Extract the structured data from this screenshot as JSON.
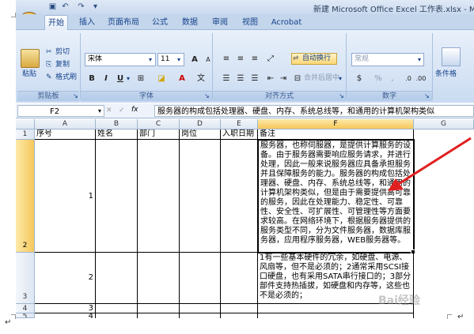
{
  "titlebar": {
    "title": "新建 Microsoft Office Excel 工作表.xlsx - M"
  },
  "tabs": [
    "开始",
    "插入",
    "页面布局",
    "公式",
    "数据",
    "审阅",
    "视图",
    "Acrobat"
  ],
  "ribbon": {
    "clipboard": {
      "paste": "粘贴",
      "cut": "剪切",
      "copy": "复制",
      "format_painter": "格式刷",
      "label": "剪贴板"
    },
    "font": {
      "name": "宋体",
      "size": "11",
      "bold": "B",
      "italic": "I",
      "underline": "U",
      "grow": "A",
      "shrink": "A",
      "label": "字体"
    },
    "alignment": {
      "wrap": "自动换行",
      "merge": "合并后居中",
      "label": "对齐方式"
    },
    "number": {
      "format": "常规",
      "percent": "%",
      "comma": ",",
      "label": "数字"
    },
    "styles": {
      "cond": "条件格"
    }
  },
  "formula_bar": {
    "name_box": "F2",
    "fx": "fx",
    "content": "服务器的构成包括处理器、硬盘、内存、系统总线等，和通用的计算机架构类似"
  },
  "grid": {
    "columns": [
      "A",
      "B",
      "C",
      "D",
      "E",
      "F",
      "G"
    ],
    "row_numbers": [
      "1",
      "2",
      "3",
      "4",
      "5"
    ],
    "header_row": [
      "序号",
      "姓名",
      "部门",
      "岗位",
      "入职日期",
      "备注"
    ],
    "row2": {
      "a": "1",
      "f": "服务器，也称伺服器，是提供计算服务的设备。由于服务器需要响应服务请求，并进行处理，因此一般来说服务器应具备承担服务并且保障服务的能力。服务器的构成包括处理器、硬盘、内存、系统总线等，和通用的计算机架构类似，但是由于需要提供高可靠的服务，因此在处理能力、稳定性、可靠性、安全性、可扩展性、可管理性等方面要求较高。在网络环境下，根据服务器提供的服务类型不同，分为文件服务器，数据库服务器，应用程序服务器，WEB服务器等。"
    },
    "row3": {
      "a": "2",
      "f": "1有一些基本硬件的冗余，如硬盘、电源、风扇等，但不是必须的；2通常采用SCSI接口硬盘，也有采用SATA串行接口的；3部分部件支持热插拔，如硬盘和内存等，这些也不是必须的；"
    },
    "row4": {
      "a": "3"
    },
    "row5": {
      "a": "4"
    }
  },
  "watermark": "Bai经验"
}
